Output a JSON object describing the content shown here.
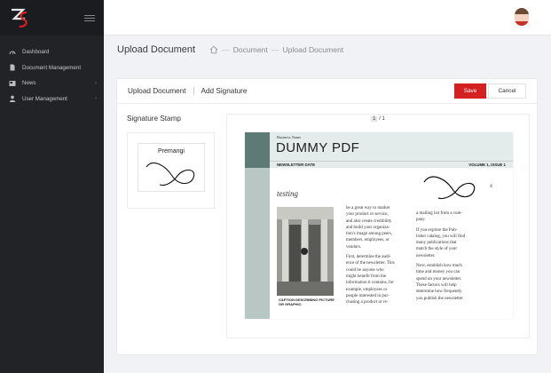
{
  "sidebar": {
    "logo_icon": "zs-logo-icon",
    "items": [
      {
        "label": "Dashboard",
        "icon": "dashboard-icon",
        "chevron": ""
      },
      {
        "label": "Document Management",
        "icon": "document-icon",
        "chevron": ""
      },
      {
        "label": "News",
        "icon": "news-icon",
        "chevron": "›"
      },
      {
        "label": "User Management",
        "icon": "user-icon",
        "chevron": "›"
      }
    ]
  },
  "header": {
    "title": "Upload Document",
    "breadcrumb": [
      "Document",
      "Upload Document"
    ],
    "separator": "—"
  },
  "tabs": [
    "Upload Document",
    "Add Signature"
  ],
  "actions": {
    "save": "Save",
    "cancel": "Cancel"
  },
  "stamp": {
    "title": "Signature Stamp",
    "name": "Premangi"
  },
  "viewer": {
    "current_page": "1",
    "separator": "/",
    "total_pages": "1"
  },
  "pdf": {
    "business_name": "Business Name",
    "title": "DUMMY PDF",
    "newsletter_date": "NEWSLETTER DATE",
    "volume": "VOLUME 1, ISSUE 1",
    "testing": "testing",
    "caption": "CAPTION DESCRIBING PICTURE OR GRAPHIC.",
    "col1_p1": "be a great way to market\nyour product or service,\nand also create credibility\nand build your organiza-\ntion's image among peers,\nmembers, employees, or\nvendors.",
    "col1_p2": "First, determine the audi-\nence of the newsletter. This\ncould be anyone who\nmight benefit from the\ninformation it contains, for\nexample, employees or\npeople interested in pur-\nchasing a product or re-",
    "col2_p1": "a mailing list from a com-\npany.",
    "col2_p2": "If you explore the Pub-\nlisher catalog, you will find\nmany publications that\nmatch the style of your\nnewsletter.",
    "col2_p3": "Next, establish how much\ntime and money you can\nspend on your newsletter.\nThese factors will help\ndetermine how frequently\nyou publish the newsletter",
    "close_mark": "x"
  },
  "colors": {
    "accent": "#d42020",
    "sidebar": "#222327",
    "pdf_band": "#5e7a74"
  }
}
